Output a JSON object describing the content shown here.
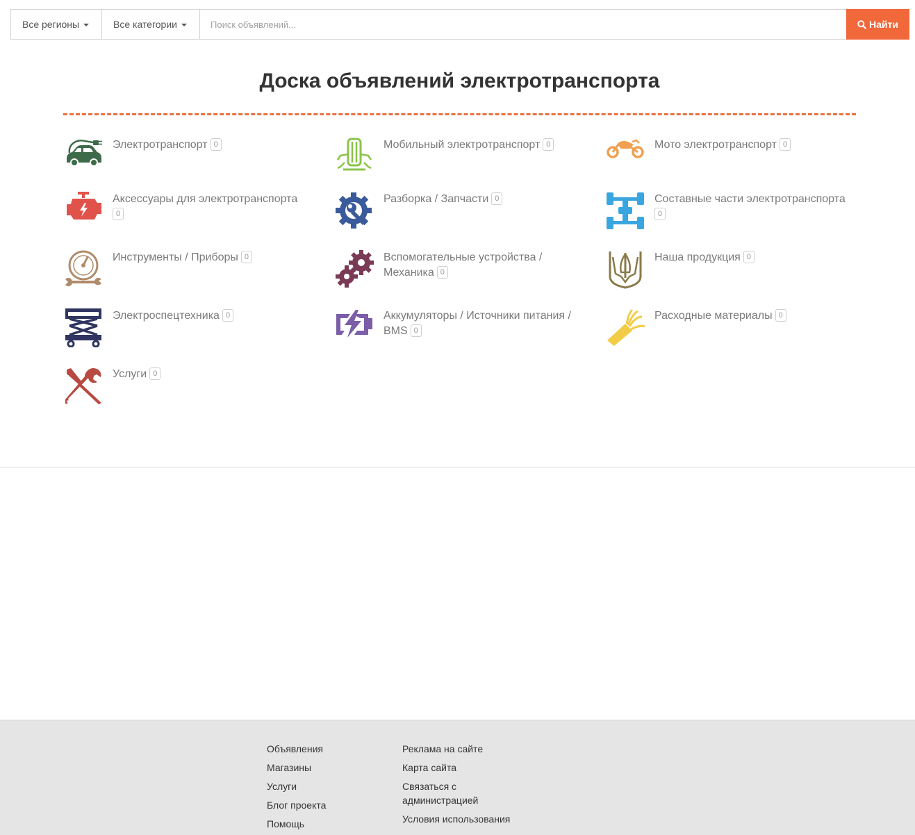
{
  "search": {
    "regions_label": "Все регионы",
    "categories_label": "Все категории",
    "placeholder": "Поиск объявлений...",
    "button_label": "Найти",
    "button_color": "#f1683a"
  },
  "page_title": "Доска объявлений электротранспорта",
  "categories": [
    {
      "label": "Электротранспорт",
      "count": "0",
      "icon": "electric-car-icon",
      "color": "#3d6b4a"
    },
    {
      "label": "Мобильный электротранспорт",
      "count": "0",
      "icon": "mobile-transport-icon",
      "color": "#8bc34a"
    },
    {
      "label": "Мото электротранспорт",
      "count": "0",
      "icon": "motorcycle-icon",
      "color": "#f0a050"
    },
    {
      "label": "Аксессуары для электротранспорта",
      "count": "0",
      "icon": "engine-icon",
      "color": "#e0524a"
    },
    {
      "label": "Разборка / Запчасти",
      "count": "0",
      "icon": "gear-wrench-icon",
      "color": "#3a5a9b"
    },
    {
      "label": "Составные части электротранспорта",
      "count": "0",
      "icon": "chassis-icon",
      "color": "#3aa6e0"
    },
    {
      "label": "Инструменты / Приборы",
      "count": "0",
      "icon": "gauge-icon",
      "color": "#b08b6a"
    },
    {
      "label": "Вспомогательные устройства / Механика",
      "count": "0",
      "icon": "gears-icon",
      "color": "#7a3a55"
    },
    {
      "label": "Наша продукция",
      "count": "0",
      "icon": "trident-icon",
      "color": "#8a7a4a"
    },
    {
      "label": "Электроспецтехника",
      "count": "0",
      "icon": "scissor-lift-icon",
      "color": "#2f3560"
    },
    {
      "label": "Аккумуляторы / Источники питания / BMS",
      "count": "0",
      "icon": "battery-icon",
      "color": "#7b5ea7"
    },
    {
      "label": "Расходные материалы",
      "count": "0",
      "icon": "cable-icon",
      "color": "#f2cc45"
    },
    {
      "label": "Услуги",
      "count": "0",
      "icon": "tools-icon",
      "color": "#b84a42"
    }
  ],
  "footer": {
    "col1": [
      "Объявления",
      "Магазины",
      "Услуги",
      "Блог проекта",
      "Помощь"
    ],
    "col2": [
      "Реклама на сайте",
      "Карта сайта",
      "Связаться с администрацией",
      "Условия использования"
    ]
  }
}
